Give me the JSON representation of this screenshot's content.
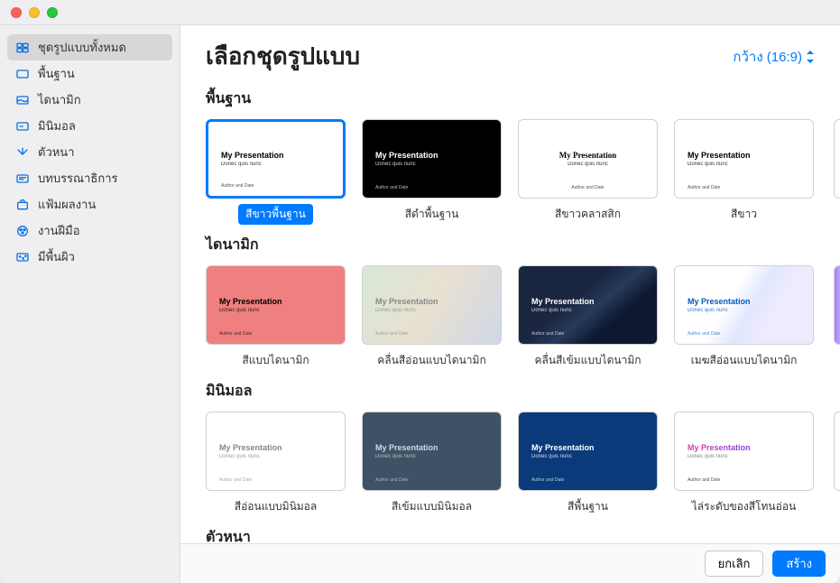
{
  "header": {
    "title": "เลือกชุดรูปแบบ",
    "aspect_label": "กว้าง (16:9)"
  },
  "footer": {
    "cancel": "ยกเลิก",
    "create": "สร้าง"
  },
  "sample": {
    "title": "My Presentation",
    "subtitle": "Donec quis nunc",
    "footer": "Author and Date"
  },
  "sidebar": {
    "items": [
      {
        "label": "ชุดรูปแบบทั้งหมด",
        "icon": "themes",
        "selected": true
      },
      {
        "label": "พื้นฐาน",
        "icon": "basic"
      },
      {
        "label": "ไดนามิก",
        "icon": "dynamic"
      },
      {
        "label": "มินิมอล",
        "icon": "minimal"
      },
      {
        "label": "ตัวหนา",
        "icon": "bold"
      },
      {
        "label": "บทบรรณาธิการ",
        "icon": "editorial"
      },
      {
        "label": "แฟ้มผลงาน",
        "icon": "portfolio"
      },
      {
        "label": "งานฝีมือ",
        "icon": "craft"
      },
      {
        "label": "มีพื้นผิว",
        "icon": "textured"
      }
    ]
  },
  "sections": [
    {
      "title": "พื้นฐาน",
      "themes": [
        {
          "label": "สีขาวพื้นฐาน",
          "cls": "th-basic-white",
          "selected": true
        },
        {
          "label": "สีดำพื้นฐาน",
          "cls": "th-basic-black"
        },
        {
          "label": "สีขาวคลาสสิก",
          "cls": "th-classic-white"
        },
        {
          "label": "สีขาว",
          "cls": "th-white"
        }
      ],
      "peek": "white"
    },
    {
      "title": "ไดนามิก",
      "themes": [
        {
          "label": "สีแบบไดนามิก",
          "cls": "th-dyn-color"
        },
        {
          "label": "คลื่นสีอ่อนแบบไดนามิก",
          "cls": "th-dyn-lightwave"
        },
        {
          "label": "คลื่นสีเข้มแบบไดนามิก",
          "cls": "th-dyn-boldwave"
        },
        {
          "label": "เมฆสีอ่อนแบบไดนามิก",
          "cls": "th-dyn-mesh"
        }
      ],
      "peek": "grad"
    },
    {
      "title": "มินิมอล",
      "themes": [
        {
          "label": "สีอ่อนแบบมินิมอล",
          "cls": "th-min-light"
        },
        {
          "label": "สีเข้มแบบมินิมอล",
          "cls": "th-min-bold"
        },
        {
          "label": "สีพื้นฐาน",
          "cls": "th-min-base"
        },
        {
          "label": "ไล่ระดับของสีโทนอ่อน",
          "cls": "th-min-grad"
        }
      ],
      "peek": "white"
    },
    {
      "title": "ตัวหนา",
      "themes": []
    }
  ]
}
